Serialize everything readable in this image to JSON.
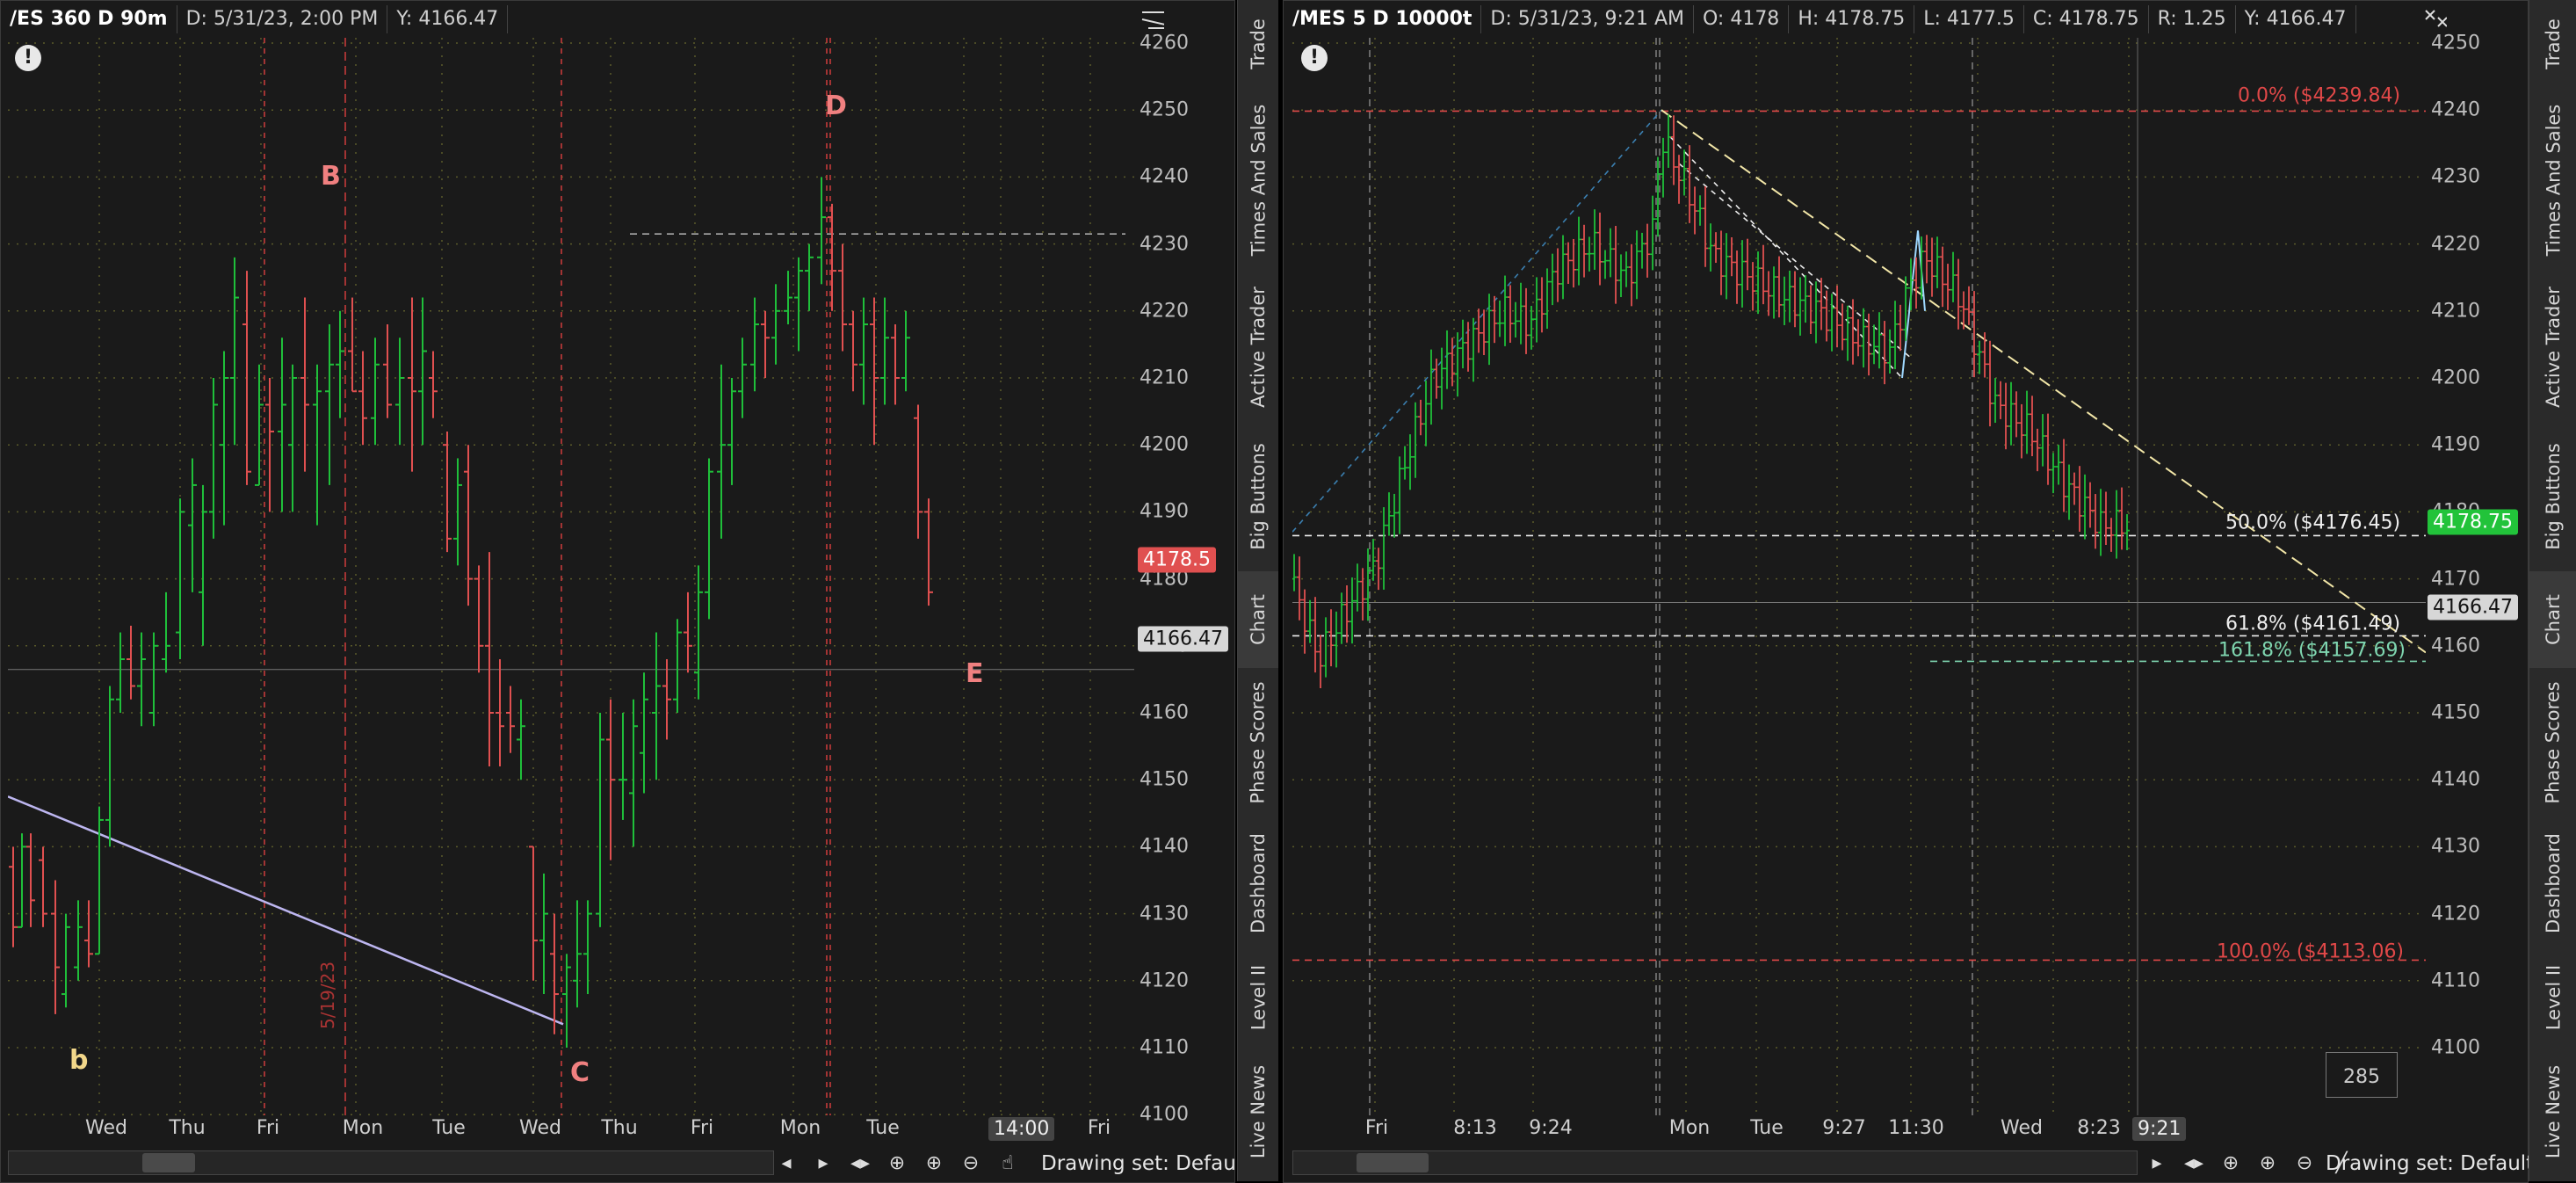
{
  "left": {
    "symbol": "/ES 360 D 90m",
    "date": "D: 5/31/23, 2:00 PM",
    "y": "Y: 4166.47",
    "price_ticks": [
      "4260",
      "4250",
      "4240",
      "4230",
      "4220",
      "4210",
      "4200",
      "4190",
      "4180",
      "4170",
      "4160",
      "4150",
      "4140",
      "4130",
      "4120",
      "4110",
      "4100"
    ],
    "time_labels": [
      "Wed",
      "Thu",
      "Fri",
      "Mon",
      "Tue",
      "Wed",
      "Thu",
      "Fri",
      "Mon",
      "Tue",
      "Fri"
    ],
    "time_tag": "14:00",
    "price_tag": "4178.5",
    "crosshair_tag": "4166.47",
    "marks": {
      "B": "B",
      "D": "D",
      "E": "E",
      "C": "C",
      "b": "b"
    },
    "date_note": "5/19/23",
    "drawing_set": "Drawing set: Default"
  },
  "right": {
    "symbol": "/MES 5 D 10000t",
    "date": "D: 5/31/23, 9:21 AM",
    "open": "O: 4178",
    "high": "H: 4178.75",
    "low": "L: 4177.5",
    "close": "C: 4178.75",
    "range": "R: 1.25",
    "y": "Y: 4166.47",
    "price_ticks": [
      "4250",
      "4240",
      "4230",
      "4220",
      "4210",
      "4200",
      "4190",
      "4180",
      "4170",
      "4160",
      "4150",
      "4140",
      "4130",
      "4120",
      "4110",
      "4100"
    ],
    "time_labels": [
      "Fri",
      "8:13",
      "9:24",
      "Mon",
      "Tue",
      "9:27",
      "11:30",
      "Wed",
      "8:23"
    ],
    "time_tag": "9:21",
    "price_tag": "4178.75",
    "crosshair_tag": "4166.47",
    "fib": {
      "f0": "0.0%  ($4239.84)",
      "f50": "50.0%  ($4176.45)",
      "f618": "61.8%  ($4161.49)",
      "f1618": "161.8%  ($4157.69)",
      "f100": "100.0%  ($4113.06)"
    },
    "badge": "285",
    "drawing_set": "Drawing set: Default"
  },
  "sidebar_tabs": [
    "Trade",
    "Times And Sales",
    "Active Trader",
    "Big Buttons",
    "Chart",
    "Phase Scores",
    "Dashboard",
    "Level II",
    "Live News"
  ],
  "alert_glyph": "!",
  "colors": {
    "bg": "#1a1a1a",
    "up": "#1fbf3a",
    "down": "#e05050",
    "price_tag_red": "#e05050",
    "price_tag_green": "#22c33a",
    "fib_red": "#e04848",
    "fib_teal": "#7fd6b0"
  }
}
